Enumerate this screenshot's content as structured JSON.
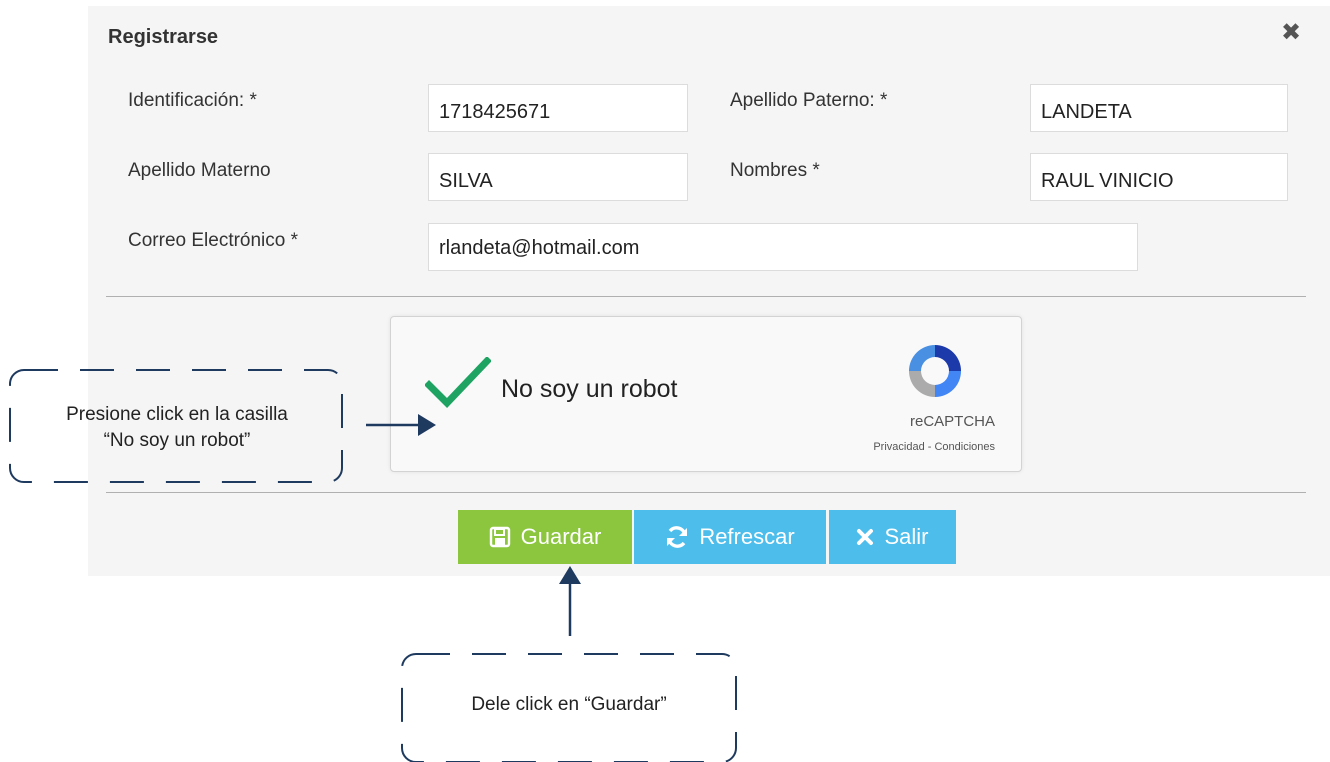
{
  "dialog": {
    "title": "Registrarse",
    "close_icon": "close-icon"
  },
  "form": {
    "identificacion": {
      "label": "Identificación: *",
      "value": "1718425671"
    },
    "apellido_paterno": {
      "label": "Apellido Paterno: *",
      "value": "LANDETA"
    },
    "apellido_materno": {
      "label": "Apellido Materno",
      "value": "SILVA"
    },
    "nombres": {
      "label": "Nombres *",
      "value": "RAUL VINICIO"
    },
    "correo": {
      "label": "Correo Electrónico *",
      "value": "rlandeta@hotmail.com"
    }
  },
  "captcha": {
    "label": "No soy un robot",
    "brand": "reCAPTCHA",
    "links": "Privacidad - Condiciones",
    "checked": true,
    "check_color": "#1ea362"
  },
  "buttons": {
    "guardar": {
      "label": "Guardar",
      "icon": "save-icon",
      "color": "#8cc63f"
    },
    "refrescar": {
      "label": "Refrescar",
      "icon": "refresh-icon",
      "color": "#4dbdec"
    },
    "salir": {
      "label": "Salir",
      "icon": "close-icon",
      "color": "#4dbdec"
    }
  },
  "annotations": {
    "captcha_hint_line1": "Presione click en la casilla",
    "captcha_hint_line2": "“No soy un robot”",
    "guardar_hint": "Dele click en “Guardar”",
    "arrow_color": "#1f3a5f"
  }
}
